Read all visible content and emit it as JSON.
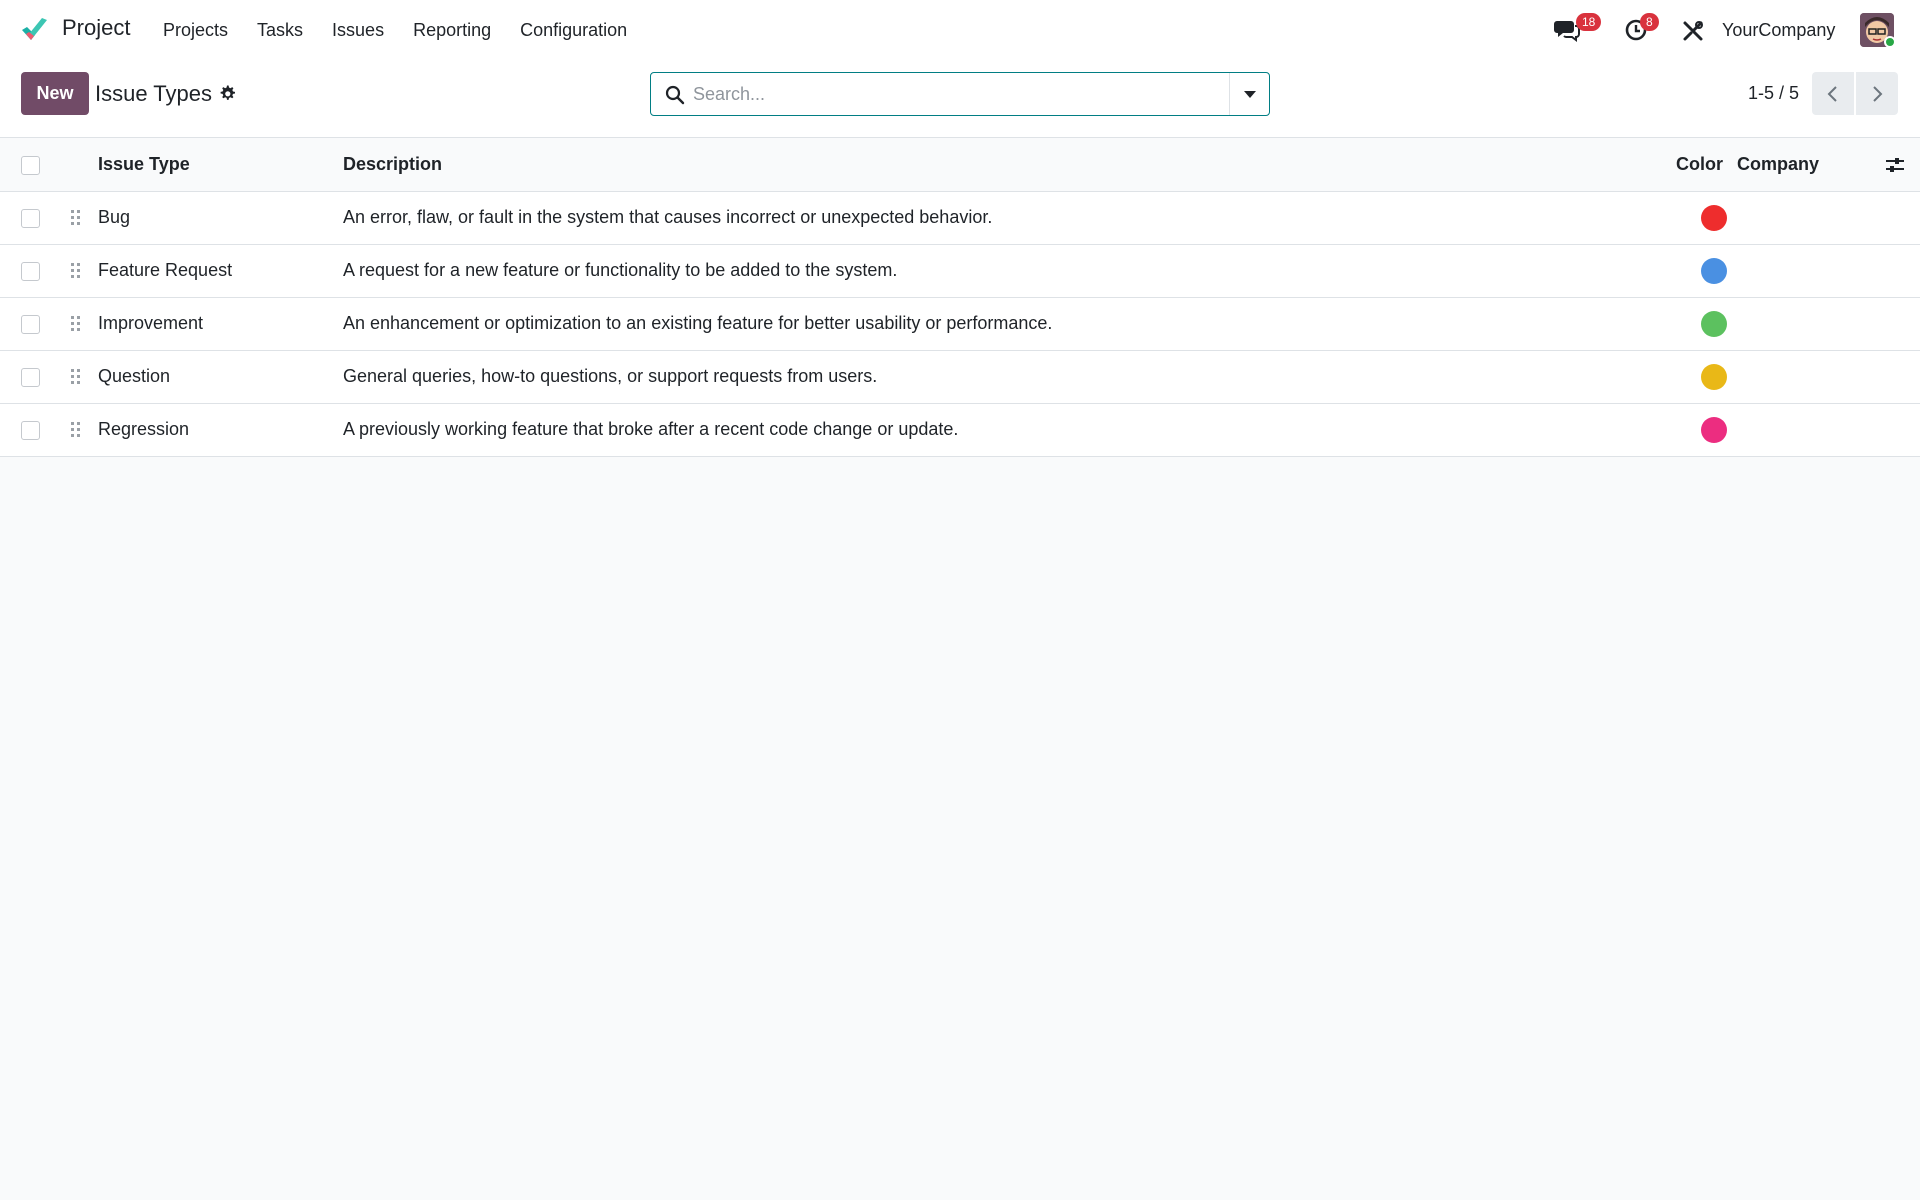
{
  "app": {
    "name": "Project",
    "brand_color": "#714b67",
    "accent_color": "#017e84"
  },
  "menu": [
    {
      "label": "Projects"
    },
    {
      "label": "Tasks"
    },
    {
      "label": "Issues"
    },
    {
      "label": "Reporting"
    },
    {
      "label": "Configuration"
    }
  ],
  "systray": {
    "messages_count": "18",
    "activities_count": "8",
    "company": "YourCompany",
    "icons": [
      "chat-icon",
      "clock-icon",
      "debug-tools-icon",
      "avatar"
    ]
  },
  "control_panel": {
    "new_label": "New",
    "title": "Issue Types",
    "search_placeholder": "Search...",
    "pager": "1-5 / 5"
  },
  "table": {
    "columns": {
      "name": "Issue Type",
      "description": "Description",
      "color": "Color",
      "company": "Company"
    },
    "rows": [
      {
        "name": "Bug",
        "description": "An error, flaw, or fault in the system that causes incorrect or unexpected behavior.",
        "color": "#ee2d2d",
        "company": ""
      },
      {
        "name": "Feature Request",
        "description": "A request for a new feature or functionality to be added to the system.",
        "color": "#4a90e2",
        "company": ""
      },
      {
        "name": "Improvement",
        "description": "An enhancement or optimization to an existing feature for better usability or performance.",
        "color": "#5cc15f",
        "company": ""
      },
      {
        "name": "Question",
        "description": "General queries, how-to questions, or support requests from users.",
        "color": "#e9b817",
        "company": ""
      },
      {
        "name": "Regression",
        "description": "A previously working feature that broke after a recent code change or update.",
        "color": "#ec2d80",
        "company": ""
      }
    ]
  }
}
